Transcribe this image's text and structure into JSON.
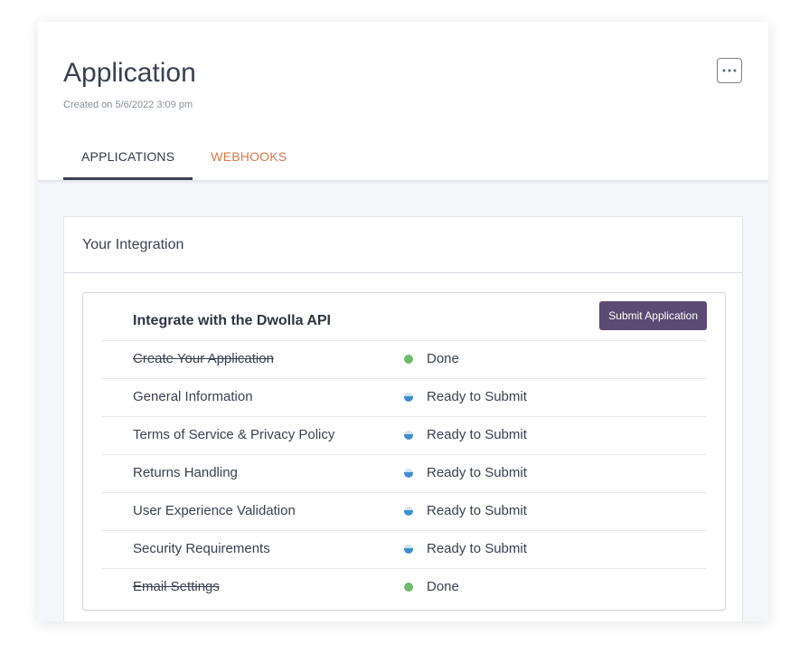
{
  "header": {
    "title": "Application",
    "created": "Created on 5/6/2022 3:09 pm",
    "more_icon": "ellipsis-icon"
  },
  "tabs": [
    {
      "label": "APPLICATIONS",
      "active": true
    },
    {
      "label": "WEBHOOKS",
      "active": false
    }
  ],
  "integration": {
    "panel_title": "Your Integration",
    "section_title": "Integrate with the Dwolla API",
    "submit_label": "Submit Application",
    "steps": [
      {
        "name": "Create Your Application",
        "status": "Done",
        "state": "done"
      },
      {
        "name": "General Information",
        "status": "Ready to Submit",
        "state": "ready"
      },
      {
        "name": "Terms of Service & Privacy Policy",
        "status": "Ready to Submit",
        "state": "ready"
      },
      {
        "name": "Returns Handling",
        "status": "Ready to Submit",
        "state": "ready"
      },
      {
        "name": "User Experience Validation",
        "status": "Ready to Submit",
        "state": "ready"
      },
      {
        "name": "Security Requirements",
        "status": "Ready to Submit",
        "state": "ready"
      },
      {
        "name": "Email Settings",
        "status": "Done",
        "state": "done"
      }
    ]
  },
  "colors": {
    "accent_tab": "#d9784a",
    "submit_button": "#5b4b72",
    "done_dot": "#6dbb6a",
    "ready_dot": "#3d8fce"
  }
}
